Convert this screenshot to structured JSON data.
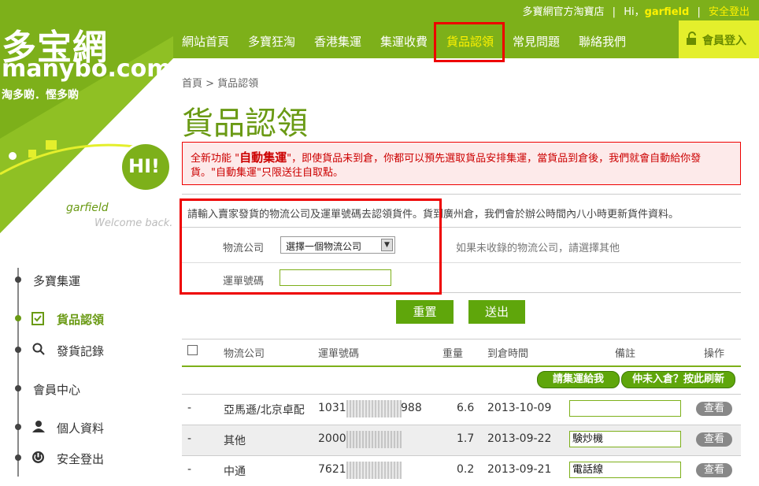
{
  "topbar": {
    "shop_link": "多寶網官方淘寶店",
    "greeting": "Hi，",
    "username": "garfield",
    "logout": "安全登出"
  },
  "nav": {
    "items": [
      "網站首頁",
      "多寶狂淘",
      "香港集運",
      "集運收費",
      "貨品認領",
      "常見問題",
      "聯絡我們"
    ],
    "active": "貨品認領",
    "login": "會員登入"
  },
  "brand": {
    "logo_top": "多宝網",
    "logo_bottom": "manybo.com",
    "slogan": "淘多啲．慳多啲",
    "hi_bubble": "HI!"
  },
  "sidebar": {
    "username": "garfield",
    "welcome": "Welcome back.",
    "sections": [
      {
        "label": "多寶集運"
      },
      {
        "label": "貨品認領",
        "active": true
      },
      {
        "label": "發貨記錄"
      },
      {
        "label": "會員中心"
      },
      {
        "label": "個人資料"
      },
      {
        "label": "安全登出"
      }
    ]
  },
  "main": {
    "breadcrumb": "首頁 > 貨品認領",
    "title": "貨品認領",
    "alert_prefix": "全新功能 \"",
    "alert_bold": "自動集運",
    "alert_rest": "\"，即使貨品未到倉，你都可以預先選取貨品安排集運，當貨品到倉後，我們就會自動給你發貨。\"自動集運\"只限送往自取點。",
    "instructions": "請輸入賣家發貨的物流公司及運單號碼去認領貨件。貨到廣州倉，我們會於辦公時間內八小時更新貨件資料。",
    "form": {
      "courier_label": "物流公司",
      "courier_value": "選擇一個物流公司",
      "courier_hint": "如果未收錄的物流公司，請選擇其他",
      "tracking_label": "運單號碼",
      "tracking_value": ""
    },
    "buttons": {
      "reset": "重置",
      "submit": "送出"
    }
  },
  "table": {
    "headers": [
      "物流公司",
      "運單號碼",
      "重量",
      "到倉時間",
      "備註",
      "操作"
    ],
    "actions": {
      "ship": "請集運給我",
      "not_arrived": "仲未入倉？按此刷新"
    },
    "rows": [
      {
        "dash": "-",
        "courier": "亞馬遜/北京卓配",
        "tracking_start": "1031",
        "tracking_end": "988",
        "weight": "6.6",
        "date": "2013-10-09",
        "note": "",
        "op": "查看"
      },
      {
        "dash": "-",
        "courier": "其他",
        "tracking_start": "2000",
        "tracking_end": "",
        "weight": "1.7",
        "date": "2013-09-22",
        "note": "験炒機",
        "op": "查看"
      },
      {
        "dash": "-",
        "courier": "中通",
        "tracking_start": "7621",
        "tracking_end": "",
        "weight": "0.2",
        "date": "2013-09-21",
        "note": "電話線",
        "op": "查看"
      }
    ]
  },
  "colors": {
    "brand_green": "#7db01a",
    "accent_yellow": "#fff200",
    "alert_red": "#e00000"
  }
}
